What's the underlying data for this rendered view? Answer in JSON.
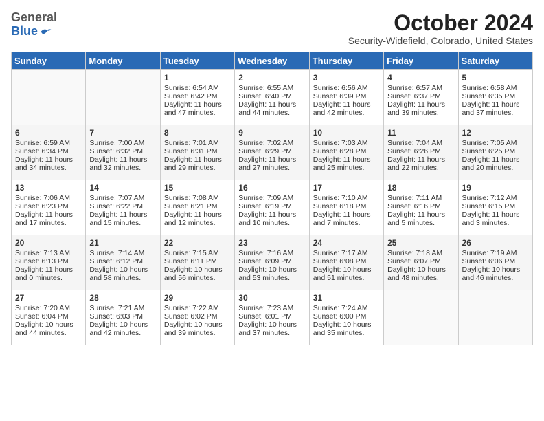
{
  "logo": {
    "general": "General",
    "blue": "Blue"
  },
  "header": {
    "month_title": "October 2024",
    "location": "Security-Widefield, Colorado, United States"
  },
  "days_of_week": [
    "Sunday",
    "Monday",
    "Tuesday",
    "Wednesday",
    "Thursday",
    "Friday",
    "Saturday"
  ],
  "weeks": [
    [
      {
        "day": "",
        "sunrise": "",
        "sunset": "",
        "daylight": ""
      },
      {
        "day": "",
        "sunrise": "",
        "sunset": "",
        "daylight": ""
      },
      {
        "day": "1",
        "sunrise": "Sunrise: 6:54 AM",
        "sunset": "Sunset: 6:42 PM",
        "daylight": "Daylight: 11 hours and 47 minutes."
      },
      {
        "day": "2",
        "sunrise": "Sunrise: 6:55 AM",
        "sunset": "Sunset: 6:40 PM",
        "daylight": "Daylight: 11 hours and 44 minutes."
      },
      {
        "day": "3",
        "sunrise": "Sunrise: 6:56 AM",
        "sunset": "Sunset: 6:39 PM",
        "daylight": "Daylight: 11 hours and 42 minutes."
      },
      {
        "day": "4",
        "sunrise": "Sunrise: 6:57 AM",
        "sunset": "Sunset: 6:37 PM",
        "daylight": "Daylight: 11 hours and 39 minutes."
      },
      {
        "day": "5",
        "sunrise": "Sunrise: 6:58 AM",
        "sunset": "Sunset: 6:35 PM",
        "daylight": "Daylight: 11 hours and 37 minutes."
      }
    ],
    [
      {
        "day": "6",
        "sunrise": "Sunrise: 6:59 AM",
        "sunset": "Sunset: 6:34 PM",
        "daylight": "Daylight: 11 hours and 34 minutes."
      },
      {
        "day": "7",
        "sunrise": "Sunrise: 7:00 AM",
        "sunset": "Sunset: 6:32 PM",
        "daylight": "Daylight: 11 hours and 32 minutes."
      },
      {
        "day": "8",
        "sunrise": "Sunrise: 7:01 AM",
        "sunset": "Sunset: 6:31 PM",
        "daylight": "Daylight: 11 hours and 29 minutes."
      },
      {
        "day": "9",
        "sunrise": "Sunrise: 7:02 AM",
        "sunset": "Sunset: 6:29 PM",
        "daylight": "Daylight: 11 hours and 27 minutes."
      },
      {
        "day": "10",
        "sunrise": "Sunrise: 7:03 AM",
        "sunset": "Sunset: 6:28 PM",
        "daylight": "Daylight: 11 hours and 25 minutes."
      },
      {
        "day": "11",
        "sunrise": "Sunrise: 7:04 AM",
        "sunset": "Sunset: 6:26 PM",
        "daylight": "Daylight: 11 hours and 22 minutes."
      },
      {
        "day": "12",
        "sunrise": "Sunrise: 7:05 AM",
        "sunset": "Sunset: 6:25 PM",
        "daylight": "Daylight: 11 hours and 20 minutes."
      }
    ],
    [
      {
        "day": "13",
        "sunrise": "Sunrise: 7:06 AM",
        "sunset": "Sunset: 6:23 PM",
        "daylight": "Daylight: 11 hours and 17 minutes."
      },
      {
        "day": "14",
        "sunrise": "Sunrise: 7:07 AM",
        "sunset": "Sunset: 6:22 PM",
        "daylight": "Daylight: 11 hours and 15 minutes."
      },
      {
        "day": "15",
        "sunrise": "Sunrise: 7:08 AM",
        "sunset": "Sunset: 6:21 PM",
        "daylight": "Daylight: 11 hours and 12 minutes."
      },
      {
        "day": "16",
        "sunrise": "Sunrise: 7:09 AM",
        "sunset": "Sunset: 6:19 PM",
        "daylight": "Daylight: 11 hours and 10 minutes."
      },
      {
        "day": "17",
        "sunrise": "Sunrise: 7:10 AM",
        "sunset": "Sunset: 6:18 PM",
        "daylight": "Daylight: 11 hours and 7 minutes."
      },
      {
        "day": "18",
        "sunrise": "Sunrise: 7:11 AM",
        "sunset": "Sunset: 6:16 PM",
        "daylight": "Daylight: 11 hours and 5 minutes."
      },
      {
        "day": "19",
        "sunrise": "Sunrise: 7:12 AM",
        "sunset": "Sunset: 6:15 PM",
        "daylight": "Daylight: 11 hours and 3 minutes."
      }
    ],
    [
      {
        "day": "20",
        "sunrise": "Sunrise: 7:13 AM",
        "sunset": "Sunset: 6:13 PM",
        "daylight": "Daylight: 11 hours and 0 minutes."
      },
      {
        "day": "21",
        "sunrise": "Sunrise: 7:14 AM",
        "sunset": "Sunset: 6:12 PM",
        "daylight": "Daylight: 10 hours and 58 minutes."
      },
      {
        "day": "22",
        "sunrise": "Sunrise: 7:15 AM",
        "sunset": "Sunset: 6:11 PM",
        "daylight": "Daylight: 10 hours and 56 minutes."
      },
      {
        "day": "23",
        "sunrise": "Sunrise: 7:16 AM",
        "sunset": "Sunset: 6:09 PM",
        "daylight": "Daylight: 10 hours and 53 minutes."
      },
      {
        "day": "24",
        "sunrise": "Sunrise: 7:17 AM",
        "sunset": "Sunset: 6:08 PM",
        "daylight": "Daylight: 10 hours and 51 minutes."
      },
      {
        "day": "25",
        "sunrise": "Sunrise: 7:18 AM",
        "sunset": "Sunset: 6:07 PM",
        "daylight": "Daylight: 10 hours and 48 minutes."
      },
      {
        "day": "26",
        "sunrise": "Sunrise: 7:19 AM",
        "sunset": "Sunset: 6:06 PM",
        "daylight": "Daylight: 10 hours and 46 minutes."
      }
    ],
    [
      {
        "day": "27",
        "sunrise": "Sunrise: 7:20 AM",
        "sunset": "Sunset: 6:04 PM",
        "daylight": "Daylight: 10 hours and 44 minutes."
      },
      {
        "day": "28",
        "sunrise": "Sunrise: 7:21 AM",
        "sunset": "Sunset: 6:03 PM",
        "daylight": "Daylight: 10 hours and 42 minutes."
      },
      {
        "day": "29",
        "sunrise": "Sunrise: 7:22 AM",
        "sunset": "Sunset: 6:02 PM",
        "daylight": "Daylight: 10 hours and 39 minutes."
      },
      {
        "day": "30",
        "sunrise": "Sunrise: 7:23 AM",
        "sunset": "Sunset: 6:01 PM",
        "daylight": "Daylight: 10 hours and 37 minutes."
      },
      {
        "day": "31",
        "sunrise": "Sunrise: 7:24 AM",
        "sunset": "Sunset: 6:00 PM",
        "daylight": "Daylight: 10 hours and 35 minutes."
      },
      {
        "day": "",
        "sunrise": "",
        "sunset": "",
        "daylight": ""
      },
      {
        "day": "",
        "sunrise": "",
        "sunset": "",
        "daylight": ""
      }
    ]
  ]
}
